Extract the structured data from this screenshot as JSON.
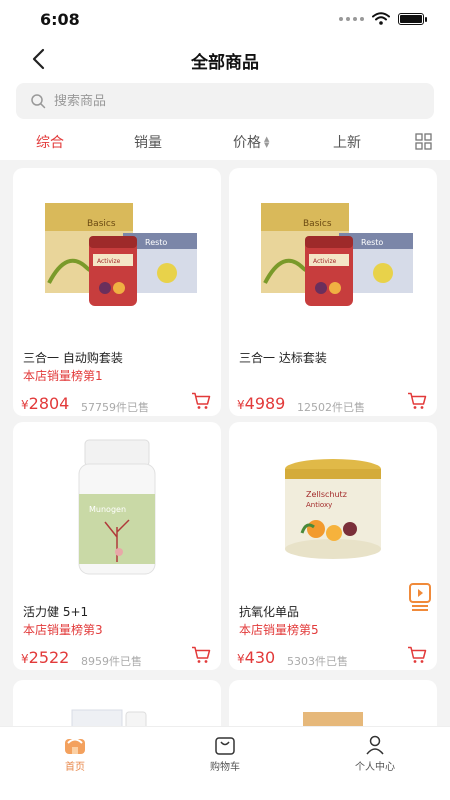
{
  "status": {
    "time": "6:08"
  },
  "nav": {
    "title": "全部商品"
  },
  "search": {
    "placeholder": "搜索商品"
  },
  "filters": [
    "综合",
    "销量",
    "价格",
    "上新"
  ],
  "products": [
    {
      "name": "三合一 自动购套装",
      "rank": "本店销量榜第1",
      "price_symbol": "¥",
      "price": "2804",
      "sold": "57759件已售"
    },
    {
      "name": "三合一 达标套装",
      "rank": "",
      "price_symbol": "¥",
      "price": "4989",
      "sold": "12502件已售"
    },
    {
      "name": "活力健 5+1",
      "rank": "本店销量榜第3",
      "price_symbol": "¥",
      "price": "2522",
      "sold": "8959件已售"
    },
    {
      "name": "抗氧化单品",
      "rank": "本店销量榜第5",
      "price_symbol": "¥",
      "price": "430",
      "sold": "5303件已售"
    }
  ],
  "product_images": {
    "basics_label": "Basics",
    "activize_label": "Activize",
    "restore_label": "Resto",
    "munogen_label": "Munogen",
    "zellschutz_label": "Zellschutz",
    "antioxy_label": "Antioxy"
  },
  "tabs": [
    {
      "label": "首页",
      "icon": "home-icon"
    },
    {
      "label": "购物车",
      "icon": "shopping-bag-icon"
    },
    {
      "label": "个人中心",
      "icon": "person-icon"
    }
  ],
  "colors": {
    "accent": "#e23a3a",
    "tab_active": "#e8884b"
  }
}
